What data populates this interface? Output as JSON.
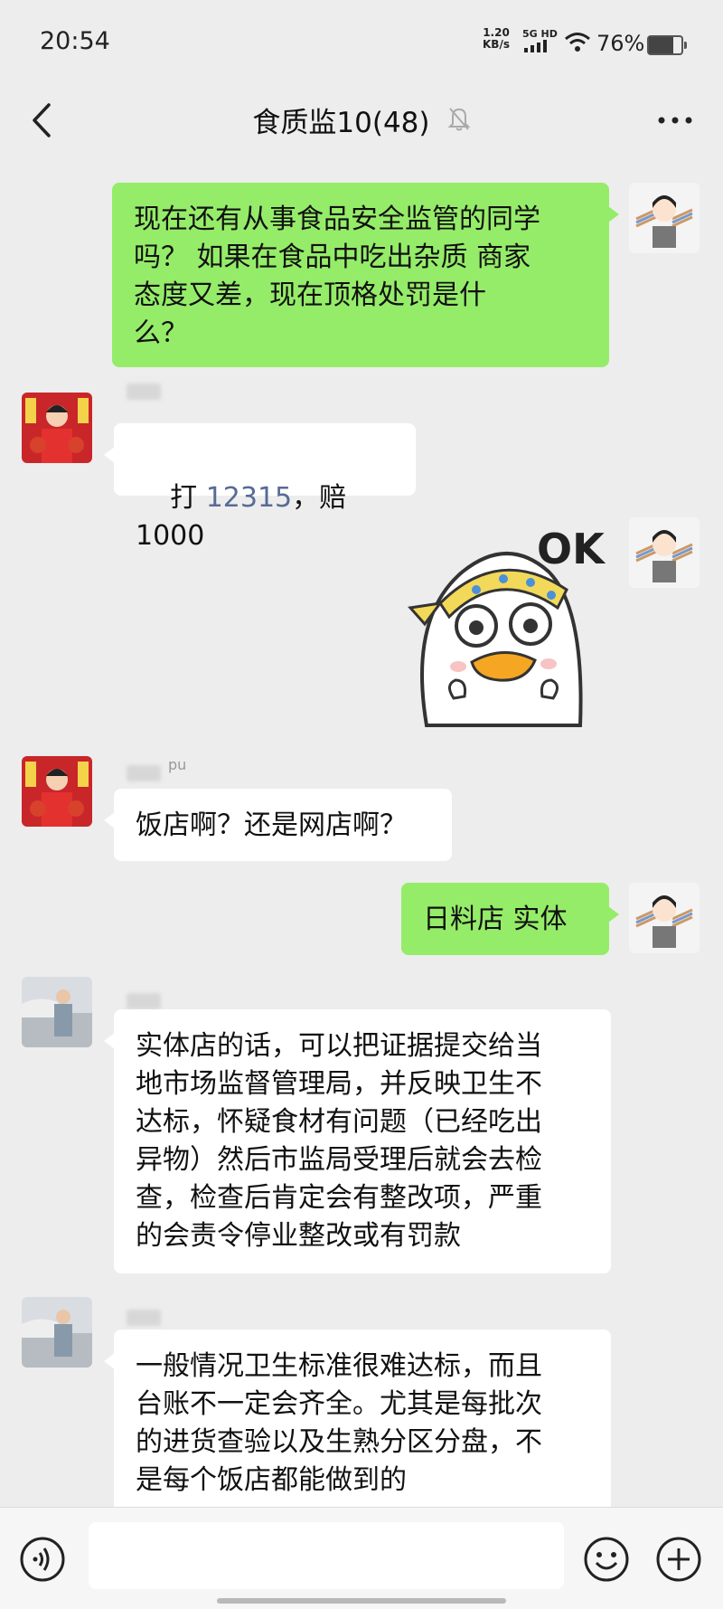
{
  "status": {
    "time": "20:54",
    "net_speed": "1.20",
    "net_unit": "KB/s",
    "net_type": "5G HD",
    "battery": "76%",
    "battery_level": 0.76
  },
  "header": {
    "title": "食质监10(48)",
    "back_icon": "chevron-left-icon",
    "mute_icon": "bell-off-icon",
    "more_icon": "more-dots-icon"
  },
  "messages": [
    {
      "side": "right",
      "text": "现在还有从事食品安全监管的同学\n吗？ 如果在食品中吃出杂质 商家\n态度又差，现在顶格处罚是什\n么？"
    },
    {
      "side": "left",
      "text_pre": "打 ",
      "link": "12315",
      "text_post": "，赔 1000"
    },
    {
      "side": "right",
      "sticker": "duck-ok-sticker",
      "sticker_text": "OK"
    },
    {
      "side": "left",
      "nick_suffix": "pu",
      "text": "饭店啊？还是网店啊？"
    },
    {
      "side": "right",
      "text": "日料店 实体"
    },
    {
      "side": "left",
      "text": "实体店的话，可以把证据提交给当\n地市场监督管理局，并反映卫生不\n达标，怀疑食材有问题（已经吃出\n异物）然后市监局受理后就会去检\n查，检查后肯定会有整改项，严重\n的会责令停业整改或有罚款"
    },
    {
      "side": "left",
      "text": "一般情况卫生标准很难达标，而且\n台账不一定会齐全。尤其是每批次\n的进货查验以及生熟分区分盘，不\n是每个饭店都能做到的"
    }
  ],
  "input_bar": {
    "voice_icon": "voice-icon",
    "emoji_icon": "emoji-icon",
    "plus_icon": "plus-circle-icon",
    "value": ""
  },
  "colors": {
    "background": "#ededed",
    "bubble_self": "#95ec69",
    "bubble_other": "#ffffff",
    "link": "#576b95"
  }
}
